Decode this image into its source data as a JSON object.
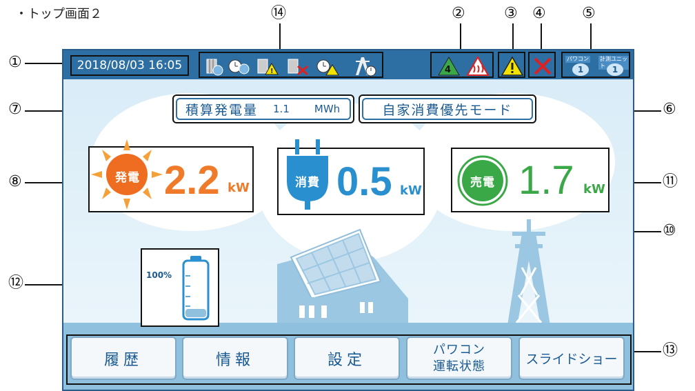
{
  "page": {
    "title": "・トップ画面２"
  },
  "callouts": {
    "c1": "①",
    "c2": "②",
    "c3": "③",
    "c4": "④",
    "c5": "⑤",
    "c6": "⑥",
    "c7": "⑦",
    "c8": "⑧",
    "c10": "⑩",
    "c11": "⑪",
    "c12": "⑫",
    "c13": "⑬",
    "c14": "⑭"
  },
  "topbar": {
    "datetime": "2018/08/03 16:05",
    "badges": {
      "pcs_label": "パワコン",
      "pcs_count": "1",
      "meter_label": "計測ユニット",
      "meter_count": "1"
    }
  },
  "summary": {
    "total_label": "積算発電量",
    "total_value": "1.1",
    "total_unit": "MWh",
    "mode_label": "自家消費優先モード"
  },
  "power": {
    "generation": {
      "label": "発電",
      "value": "2.2",
      "unit": "kW",
      "color": "#ef7b2a"
    },
    "consumption": {
      "label": "消費",
      "value": "0.5",
      "unit": "kW",
      "color": "#2a8fcf"
    },
    "sale": {
      "label": "売電",
      "value": "1.7",
      "unit": "kW",
      "color": "#3aa847"
    }
  },
  "battery": {
    "percent": "100%",
    "level": 0.15
  },
  "nav": {
    "history": "履歴",
    "info": "情報",
    "settings": "設定",
    "pcs_line1": "パワコン",
    "pcs_line2": "運転状態",
    "slideshow": "スライドショー"
  },
  "colors": {
    "topbar": "#2e6fa3",
    "warning": "#f2e200",
    "error": "#e02020",
    "accent": "#2a8fcf"
  }
}
